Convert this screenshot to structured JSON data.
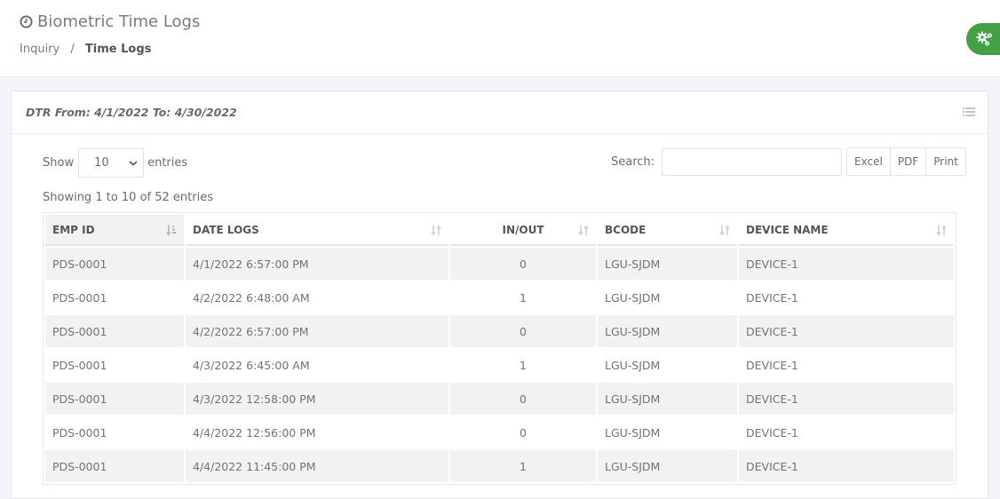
{
  "header": {
    "title": "Biometric Time Logs",
    "title_icon": "clock-icon",
    "breadcrumb": [
      {
        "label": "Inquiry"
      },
      {
        "label": "Time Logs",
        "current": true
      }
    ],
    "breadcrumb_separator": "/",
    "settings_icon": "cogs-icon",
    "accent_color": "#43a047"
  },
  "card": {
    "title": "DTR From: 4/1/2022 To: 4/30/2022",
    "menu_icon": "list-icon"
  },
  "controls": {
    "show_label": "Show",
    "entries_label": "entries",
    "page_length": "10",
    "search_label": "Search:",
    "search_value": "",
    "search_placeholder": "",
    "export_buttons": [
      "Excel",
      "PDF",
      "Print"
    ],
    "info": "Showing 1 to 10 of 52 entries"
  },
  "table": {
    "columns": [
      {
        "label": "EMP ID",
        "sort": "ascending"
      },
      {
        "label": "DATE LOGS",
        "sort": "none"
      },
      {
        "label": "IN/OUT",
        "sort": "none"
      },
      {
        "label": "BCODE",
        "sort": "none"
      },
      {
        "label": "DEVICE NAME",
        "sort": "none"
      }
    ],
    "rows": [
      [
        "PDS-0001",
        "4/1/2022 6:57:00 PM",
        "0",
        "LGU-SJDM",
        "DEVICE-1"
      ],
      [
        "PDS-0001",
        "4/2/2022 6:48:00 AM",
        "1",
        "LGU-SJDM",
        "DEVICE-1"
      ],
      [
        "PDS-0001",
        "4/2/2022 6:57:00 PM",
        "0",
        "LGU-SJDM",
        "DEVICE-1"
      ],
      [
        "PDS-0001",
        "4/3/2022 6:45:00 AM",
        "1",
        "LGU-SJDM",
        "DEVICE-1"
      ],
      [
        "PDS-0001",
        "4/3/2022 12:58:00 PM",
        "0",
        "LGU-SJDM",
        "DEVICE-1"
      ],
      [
        "PDS-0001",
        "4/4/2022 12:56:00 PM",
        "0",
        "LGU-SJDM",
        "DEVICE-1"
      ],
      [
        "PDS-0001",
        "4/4/2022 11:45:00 PM",
        "1",
        "LGU-SJDM",
        "DEVICE-1"
      ]
    ]
  }
}
